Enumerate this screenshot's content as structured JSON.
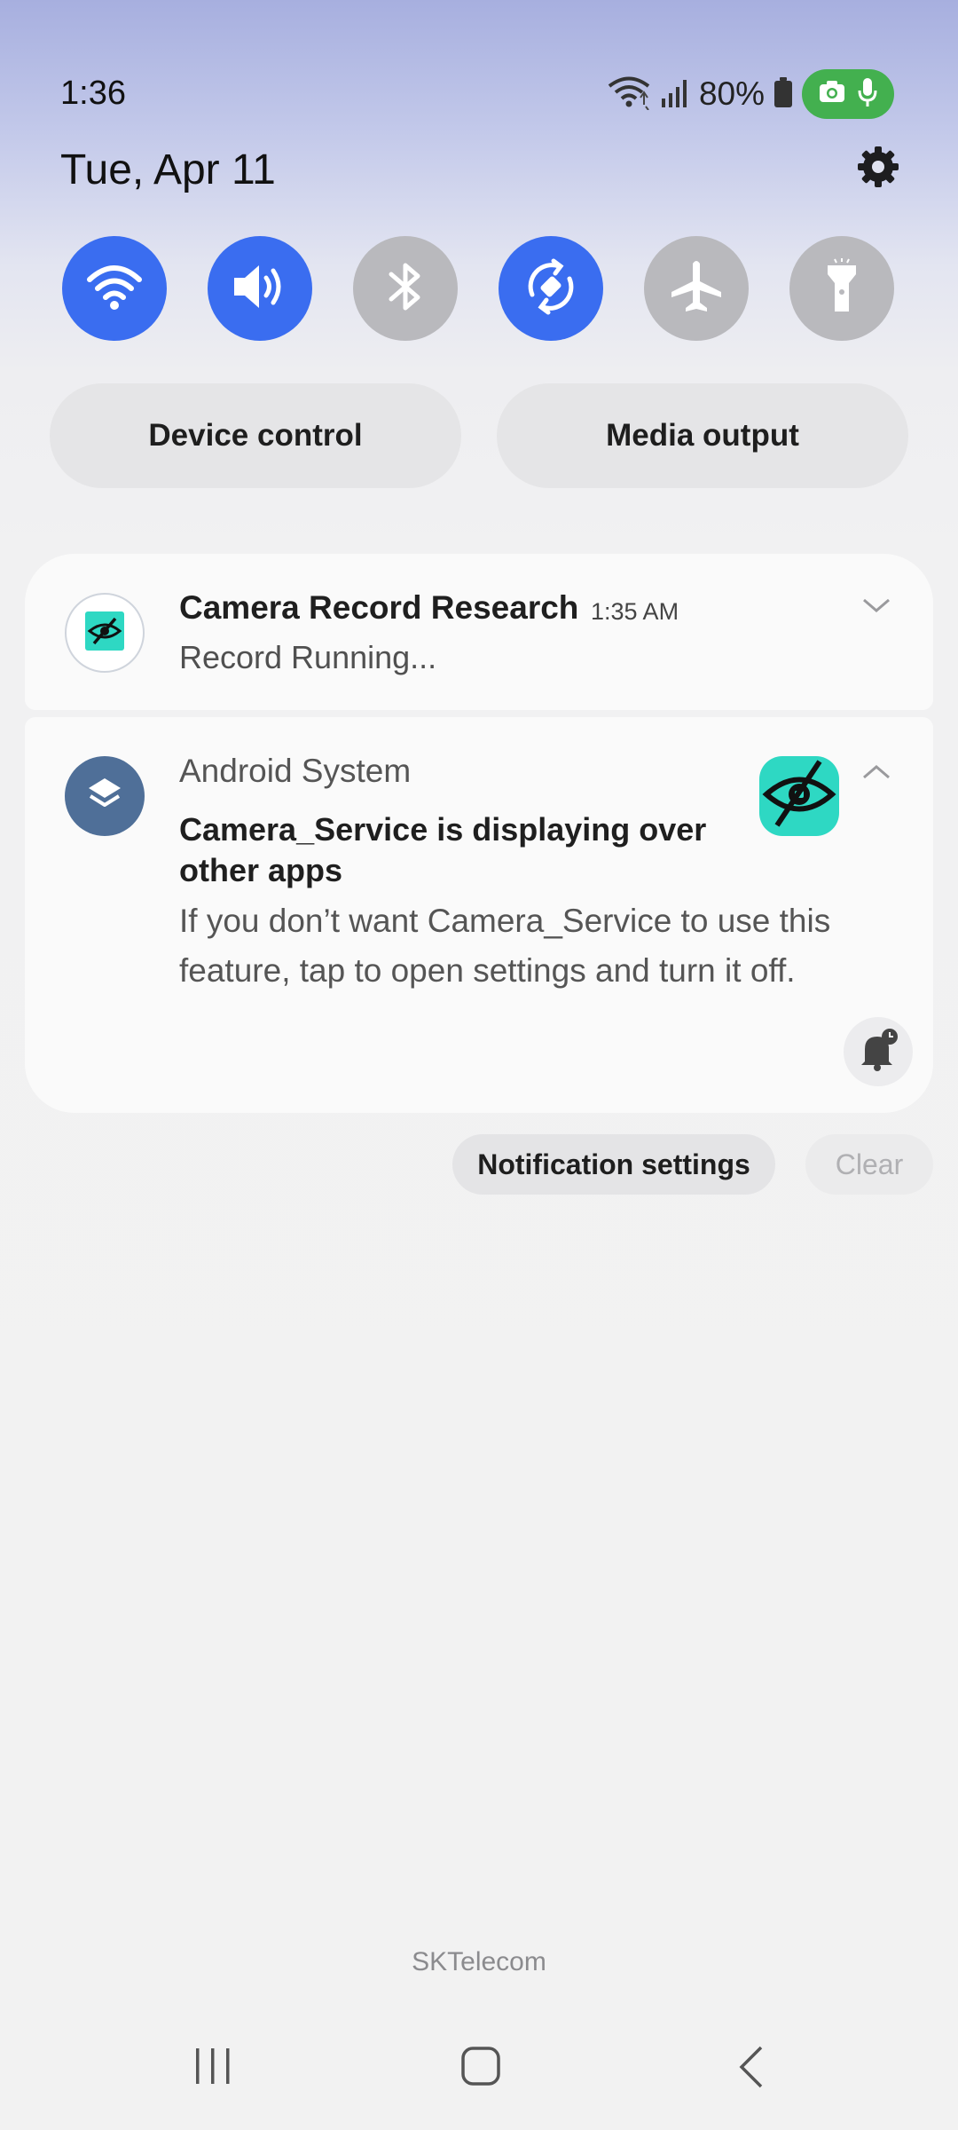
{
  "status_bar": {
    "time": "1:36",
    "battery_percent": "80%",
    "icons": [
      "wifi-icon",
      "signal-icon",
      "battery-icon",
      "camera-in-use-icon",
      "microphone-in-use-icon"
    ],
    "privacy_indicator_color": "#43b04f"
  },
  "header": {
    "date": "Tue, Apr 11",
    "settings_icon": "gear-icon"
  },
  "quick_settings": {
    "tiles": [
      {
        "name": "Wi-Fi",
        "icon": "wifi-icon",
        "state": "on"
      },
      {
        "name": "Sound",
        "icon": "speaker-icon",
        "state": "on"
      },
      {
        "name": "Bluetooth",
        "icon": "bluetooth-icon",
        "state": "off"
      },
      {
        "name": "Auto rotate",
        "icon": "rotate-icon",
        "state": "on"
      },
      {
        "name": "Airplane mode",
        "icon": "airplane-icon",
        "state": "off"
      },
      {
        "name": "Flashlight",
        "icon": "flashlight-icon",
        "state": "off"
      }
    ],
    "active_color": "#3a6df0",
    "inactive_color": "#b9b9bd",
    "device_control_label": "Device control",
    "media_output_label": "Media output"
  },
  "notifications": [
    {
      "app_title": "Camera Record Research",
      "time": "1:35 AM",
      "text": "Record Running...",
      "icon": "eye-slash-icon",
      "expanded": false
    },
    {
      "app_name": "Android System",
      "title": "Camera_Service is displaying over other apps",
      "body": "If you don’t want Camera_Service to use this feature, tap to open settings and turn it off.",
      "icon": "layers-icon",
      "large_icon": "eye-slash-icon",
      "expanded": true
    }
  ],
  "actions": {
    "notification_settings_label": "Notification settings",
    "clear_label": "Clear"
  },
  "carrier": "SKTelecom",
  "nav": {
    "recents_icon": "recents-icon",
    "home_icon": "home-icon",
    "back_icon": "back-icon"
  }
}
